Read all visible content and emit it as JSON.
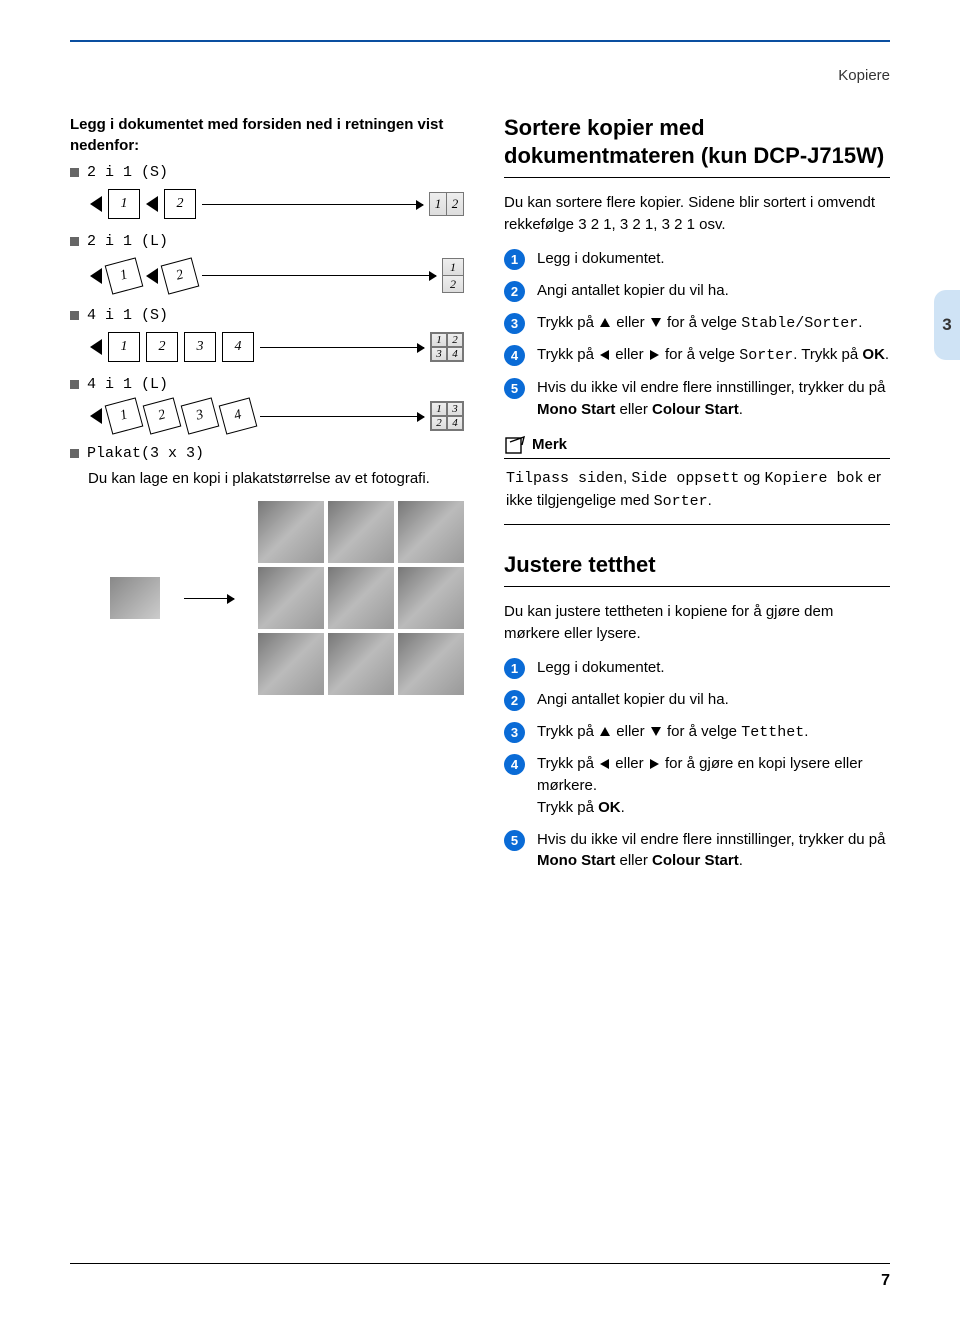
{
  "header": {
    "chapter": "Kopiere"
  },
  "tab": {
    "num": "3"
  },
  "left": {
    "intro": "Legg i dokumentet med forsiden ned i retningen vist nedenfor:",
    "items": {
      "a": "2 i 1 (S)",
      "b": "2 i 1 (L)",
      "c": "4 i 1 (S)",
      "d": "4 i 1 (L)",
      "e": "Plakat(3 x 3)"
    },
    "poster_desc": "Du kan lage en kopi i plakatstørrelse av et fotografi."
  },
  "right": {
    "sec1_title": "Sortere kopier med dokumentmateren (kun DCP-J715W)",
    "sec1_intro": "Du kan sortere flere kopier. Sidene blir sortert i omvendt rekkefølge 3 2 1, 3 2 1, 3 2 1 osv.",
    "steps1": {
      "s1": "Legg i dokumentet.",
      "s2": "Angi antallet kopier du vil ha.",
      "s3a": "Trykk på ",
      "s3b": " eller ",
      "s3c": " for å velge ",
      "s3d": "Stable/Sorter",
      "s3e": ".",
      "s4a": "Trykk på ",
      "s4b": " eller ",
      "s4c": " for å velge ",
      "s4d": "Sorter",
      "s4e": ". Trykk på ",
      "s4f": "OK",
      "s4g": ".",
      "s5a": "Hvis du ikke vil endre flere innstillinger, trykker du på ",
      "s5b": "Mono Start",
      "s5c": " eller ",
      "s5d": "Colour Start",
      "s5e": "."
    },
    "note_label": "Merk",
    "note": {
      "a": "Tilpass siden",
      "b": ", ",
      "c": "Side oppsett",
      "d": " og ",
      "e": "Kopiere bok",
      "f": " er ikke tilgjengelige med ",
      "g": "Sorter",
      "h": "."
    },
    "sec2_title": "Justere tetthet",
    "sec2_intro": "Du kan justere tettheten i kopiene for å gjøre dem mørkere eller lysere.",
    "steps2": {
      "s1": "Legg i dokumentet.",
      "s2": "Angi antallet kopier du vil ha.",
      "s3a": "Trykk på ",
      "s3b": " eller ",
      "s3c": " for å velge ",
      "s3d": "Tetthet",
      "s3e": ".",
      "s4a": "Trykk på ",
      "s4b": " eller ",
      "s4c": " for å gjøre en kopi lysere eller mørkere.",
      "s4d": "Trykk på ",
      "s4e": "OK",
      "s4f": ".",
      "s5a": "Hvis du ikke vil endre flere innstillinger, trykker du på ",
      "s5b": "Mono Start",
      "s5c": " eller ",
      "s5d": "Colour Start",
      "s5e": "."
    }
  },
  "page_number": "7"
}
